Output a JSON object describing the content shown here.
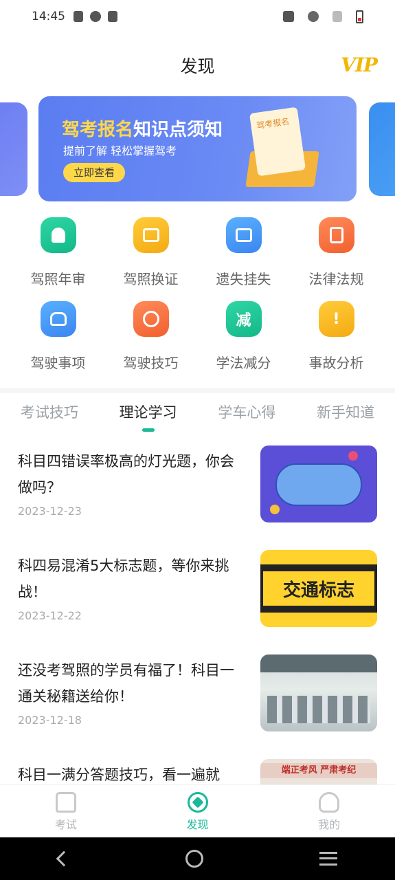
{
  "status": {
    "time": "14:45"
  },
  "header": {
    "title": "发现",
    "vip": "VIP"
  },
  "banner": {
    "title_highlight": "驾考报名",
    "title_rest": "知识点须知",
    "subtitle": "提前了解 轻松掌握驾考",
    "button": "立即查看",
    "doc_label": "驾考报名"
  },
  "services": [
    {
      "label": "驾照年审",
      "icon": "stamp-icon",
      "color": "green"
    },
    {
      "label": "驾照换证",
      "icon": "id-card-icon",
      "color": "yellow"
    },
    {
      "label": "遗失挂失",
      "icon": "lost-card-icon",
      "color": "blue"
    },
    {
      "label": "法律法规",
      "icon": "law-book-icon",
      "color": "orange"
    },
    {
      "label": "驾驶事项",
      "icon": "car-icon",
      "color": "blue"
    },
    {
      "label": "驾驶技巧",
      "icon": "steering-wheel-icon",
      "color": "orange"
    },
    {
      "label": "学法减分",
      "icon": "deduct-badge-icon",
      "color": "green",
      "glyph": "减"
    },
    {
      "label": "事故分析",
      "icon": "warning-icon",
      "color": "yellow",
      "glyph": "!"
    }
  ],
  "tabs": [
    "考试技巧",
    "理论学习",
    "学车心得",
    "新手知道"
  ],
  "active_tab": 1,
  "articles": [
    {
      "title": "科目四错误率极高的灯光题，你会做吗？",
      "date": "2023-12-23"
    },
    {
      "title": "科四易混淆5大标志题，等你来挑战！",
      "date": "2023-12-22",
      "thumb_text": "交通标志"
    },
    {
      "title": "还没考驾照的学员有福了！科目一通关秘籍送给你！",
      "date": "2023-12-18"
    },
    {
      "title": "科目一满分答题技巧，看一遍就",
      "date": "",
      "thumb_text": "端正考风 严肃考纪"
    }
  ],
  "bottom_nav": [
    {
      "label": "考试",
      "icon": "home-icon"
    },
    {
      "label": "发现",
      "icon": "compass-icon"
    },
    {
      "label": "我的",
      "icon": "user-icon"
    }
  ],
  "active_nav": 1,
  "colors": {
    "accent": "#19b99a",
    "banner": "#5a7df1",
    "vip": "#f2b705"
  }
}
